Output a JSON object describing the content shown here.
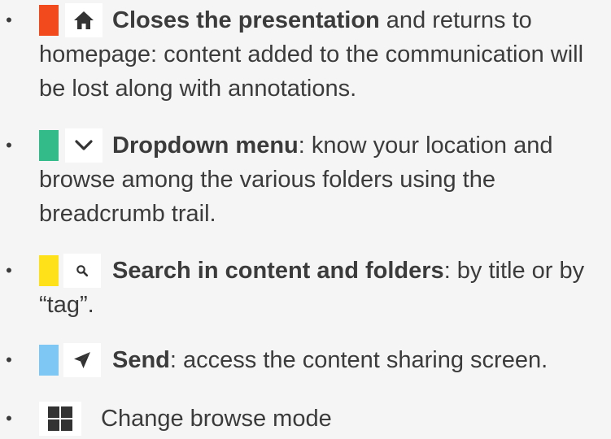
{
  "items": [
    {
      "bullet": "•",
      "swatch_color": "#f24a1c",
      "icon": "home-icon",
      "title": "Closes the presentation",
      "desc": " and returns to homepage: content added to the communication will be lost along with annotations."
    },
    {
      "bullet": "•",
      "swatch_color": "#33bb8a",
      "icon": "chevron-down-icon",
      "title": "Dropdown menu",
      "desc": ": know your location and browse among the various folders using the breadcrumb trail."
    },
    {
      "bullet": "•",
      "swatch_color": "#ffe119",
      "icon": "search-icon",
      "title": "Search in content and folders",
      "desc": ": by title or by “tag”."
    },
    {
      "bullet": "•",
      "swatch_color": "#7ec6f3",
      "icon": "send-icon",
      "title": "Send",
      "desc": ": access the content sharing screen."
    },
    {
      "bullet": "•",
      "icon": "grid-icon",
      "label": "Change browse mode"
    }
  ],
  "colors": {
    "text": "#3b3b3b",
    "background": "#f5f5f5",
    "icon": "#333333"
  }
}
